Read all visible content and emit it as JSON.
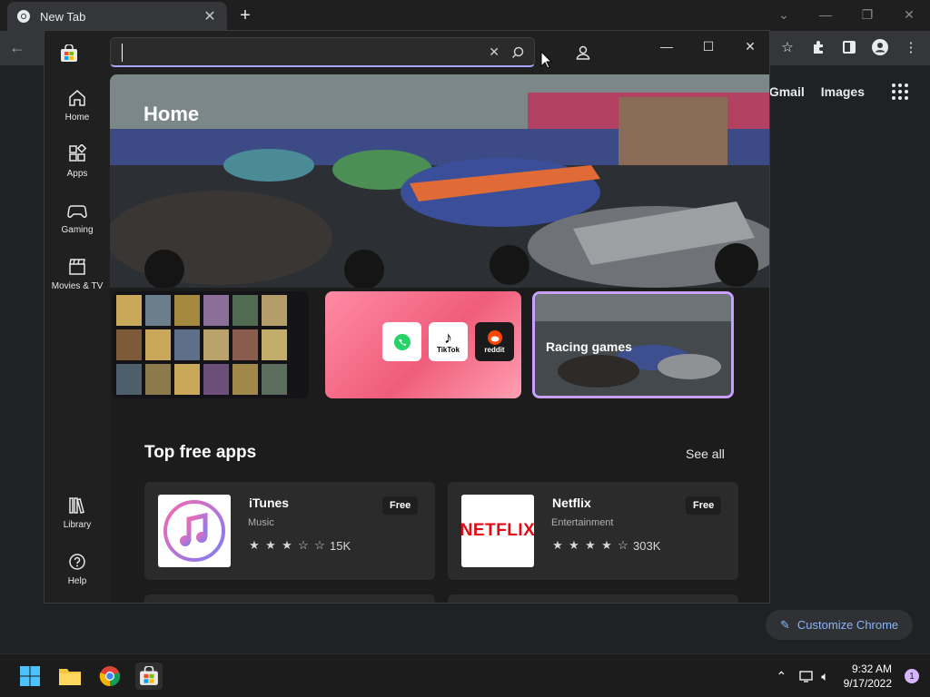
{
  "chrome": {
    "tab_title": "New Tab",
    "ntp_links": [
      "Gmail",
      "Images"
    ],
    "customize_label": "Customize Chrome"
  },
  "store": {
    "search": {
      "value": "",
      "placeholder": ""
    },
    "nav": {
      "home": "Home",
      "apps": "Apps",
      "gaming": "Gaming",
      "movies": "Movies & TV",
      "library": "Library",
      "help": "Help"
    },
    "hero_title": "Home",
    "promos": {
      "apps": [
        "TikTok",
        "reddit"
      ],
      "racing_label": "Racing games"
    },
    "section_title": "Top free apps",
    "see_all": "See all",
    "apps": [
      {
        "name": "iTunes",
        "category": "Music",
        "price": "Free",
        "rating": 3,
        "count": "15K"
      },
      {
        "name": "Netflix",
        "category": "Entertainment",
        "price": "Free",
        "rating": 4,
        "count": "303K",
        "logo_text": "NETFLIX"
      }
    ]
  },
  "taskbar": {
    "time": "9:32 AM",
    "date": "9/17/2022",
    "notification_count": "1"
  },
  "colors": {
    "store_accent": "#c9a0ff",
    "netflix_red": "#e50914",
    "chrome_link": "#8ab4f8"
  }
}
